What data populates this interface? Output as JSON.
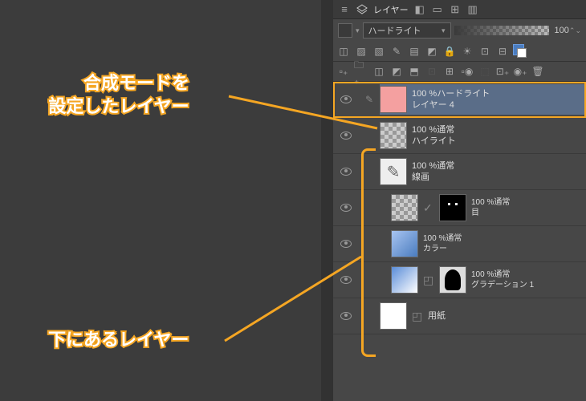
{
  "panel": {
    "title": "レイヤー"
  },
  "blend": {
    "mode": "ハードライト",
    "opacity": "100"
  },
  "annotations": {
    "top": "　　合成モードを\n設定したレイヤー",
    "bottom": "下にあるレイヤー"
  },
  "layers": [
    {
      "opacity": "100 %ハードライト",
      "name": "レイヤー 4"
    },
    {
      "opacity": "100 %通常",
      "name": "ハイライト"
    },
    {
      "opacity": "100 %通常",
      "name": "線画"
    },
    {
      "opacity": "100 %通常",
      "name": "目"
    },
    {
      "opacity": "100 %通常",
      "name": "カラー"
    },
    {
      "opacity": "100 %通常",
      "name": "グラデーション 1"
    },
    {
      "opacity": "",
      "name": "用紙"
    }
  ]
}
